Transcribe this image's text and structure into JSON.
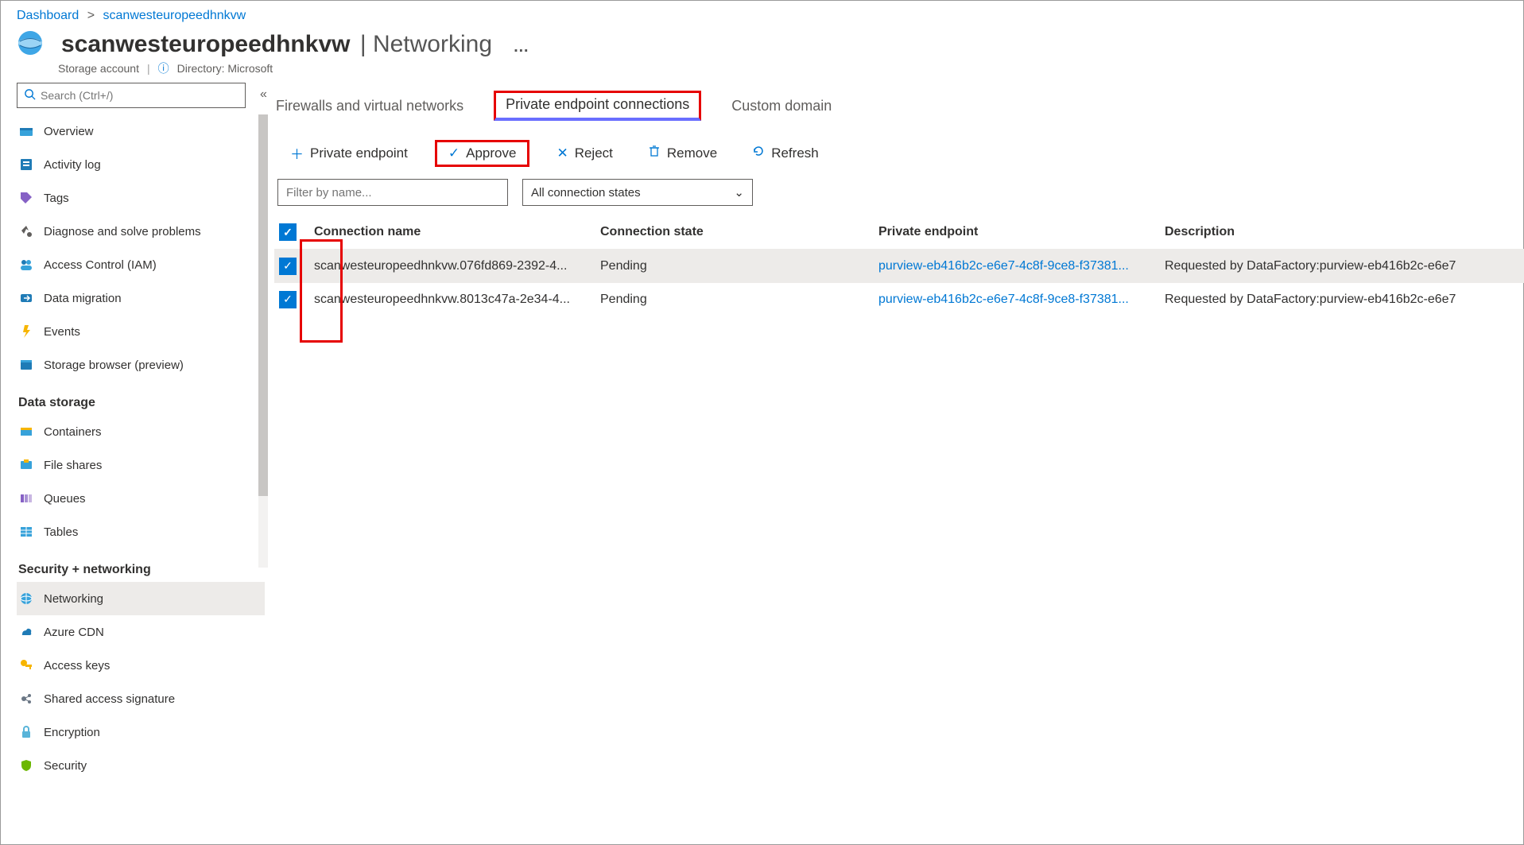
{
  "breadcrumb": {
    "root": "Dashboard",
    "current": "scanwesteuropeedhnkvw"
  },
  "header": {
    "resource_name": "scanwesteuropeedhnkvw",
    "page_title": "Networking",
    "resource_type": "Storage account",
    "directory_label": "Directory: Microsoft"
  },
  "search": {
    "placeholder": "Search (Ctrl+/)"
  },
  "sidebar": {
    "top": [
      {
        "label": "Overview",
        "icon": "overview"
      },
      {
        "label": "Activity log",
        "icon": "activity"
      },
      {
        "label": "Tags",
        "icon": "tags"
      },
      {
        "label": "Diagnose and solve problems",
        "icon": "diagnose"
      },
      {
        "label": "Access Control (IAM)",
        "icon": "iam"
      },
      {
        "label": "Data migration",
        "icon": "migration"
      },
      {
        "label": "Events",
        "icon": "events"
      },
      {
        "label": "Storage browser (preview)",
        "icon": "browser"
      }
    ],
    "groups": [
      {
        "title": "Data storage",
        "items": [
          {
            "label": "Containers",
            "icon": "containers"
          },
          {
            "label": "File shares",
            "icon": "fileshares"
          },
          {
            "label": "Queues",
            "icon": "queues"
          },
          {
            "label": "Tables",
            "icon": "tables"
          }
        ]
      },
      {
        "title": "Security + networking",
        "items": [
          {
            "label": "Networking",
            "icon": "networking",
            "selected": true
          },
          {
            "label": "Azure CDN",
            "icon": "cdn"
          },
          {
            "label": "Access keys",
            "icon": "keys"
          },
          {
            "label": "Shared access signature",
            "icon": "sas"
          },
          {
            "label": "Encryption",
            "icon": "encryption"
          },
          {
            "label": "Security",
            "icon": "security"
          }
        ]
      }
    ]
  },
  "tabs": {
    "firewalls": "Firewalls and virtual networks",
    "private_endpoints": "Private endpoint connections",
    "custom_domain": "Custom domain"
  },
  "cmd": {
    "add": "Private endpoint",
    "approve": "Approve",
    "reject": "Reject",
    "remove": "Remove",
    "refresh": "Refresh"
  },
  "filter": {
    "placeholder": "Filter by name...",
    "state_selected": "All connection states"
  },
  "table": {
    "headers": {
      "name": "Connection name",
      "state": "Connection state",
      "endpoint": "Private endpoint",
      "desc": "Description"
    },
    "rows": [
      {
        "name": "scanwesteuropeedhnkvw.076fd869-2392-4...",
        "state": "Pending",
        "endpoint": "purview-eb416b2c-e6e7-4c8f-9ce8-f37381...",
        "desc": "Requested by DataFactory:purview-eb416b2c-e6e7"
      },
      {
        "name": "scanwesteuropeedhnkvw.8013c47a-2e34-4...",
        "state": "Pending",
        "endpoint": "purview-eb416b2c-e6e7-4c8f-9ce8-f37381...",
        "desc": "Requested by DataFactory:purview-eb416b2c-e6e7"
      }
    ]
  },
  "colors": {
    "accent": "#0078d4",
    "highlight": "#e60000"
  }
}
